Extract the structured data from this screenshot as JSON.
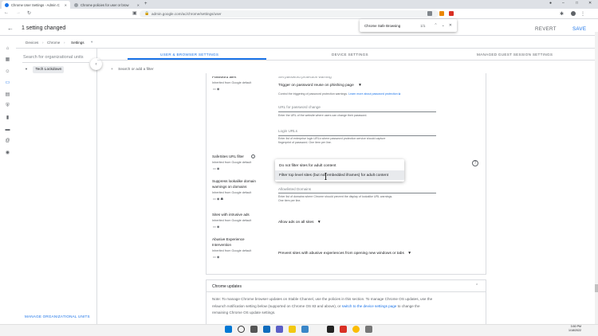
{
  "browser": {
    "tabs": [
      {
        "label": "Chrome User Settings - Admin C",
        "active": true
      },
      {
        "label": "Chrome policies for user or brow",
        "active": false
      }
    ],
    "url": "admin.google.com/ac/chrome/settings/user",
    "find": {
      "query": "Chrome Safe Browsing",
      "count": "1/1"
    }
  },
  "header": {
    "title": "1 setting changed",
    "revert_label": "REVERT",
    "save_label": "SAVE"
  },
  "breadcrumb": [
    "Devices",
    "Chrome",
    "Settings"
  ],
  "org": {
    "search_placeholder": "Search for organizational units",
    "selected": "Tech Lockdown",
    "manage_label": "MANAGE ORGANIZATIONAL UNITS"
  },
  "filter": {
    "placeholder": "Search or add a filter"
  },
  "tabs": [
    {
      "label": "USER & BROWSER SETTINGS",
      "active": true
    },
    {
      "label": "DEVICE SETTINGS",
      "active": false
    },
    {
      "label": "MANAGED GUEST SESSION SETTINGS",
      "active": false
    }
  ],
  "settings": {
    "password": {
      "label": "Password alert",
      "inherited": "Inherited from Google default",
      "warning_label": "Set password protection warning",
      "warning_value": "Trigger on password reuse on phishing page",
      "warning_desc": "Control the triggering of password protection warnings.",
      "warning_link": "Learn more about password protection",
      "change_url_label": "URL for password change",
      "change_url_desc": "Enter the URL of the website where users can change their password.",
      "login_urls_label": "Login URLs",
      "login_urls_desc_1": "Enter list of enterprise login URLs where password protection service should capture",
      "login_urls_desc_2": "fingerprint of password. One item per line."
    },
    "safesites": {
      "label": "SafeSites URL filter",
      "inherited": "Inherited from Google default",
      "options": [
        "Do not filter sites for adult content",
        "Filter top level sites (but not embedded iframes) for adult content"
      ]
    },
    "lookalike": {
      "label_1": "Suppress lookalike domain",
      "label_2": "warnings on domains",
      "inherited": "Inherited from Google default",
      "allowed_label": "Allowlisted Domains",
      "allowed_desc_1": "Enter list of domains where Chrome should prevent the display of lookalike URL warnings.",
      "allowed_desc_2": "One item per line."
    },
    "intrusive_ads": {
      "label": "Sites with intrusive ads",
      "inherited": "Inherited from Google default",
      "value": "Allow ads on all sites"
    },
    "abusive": {
      "label_1": "Abusive Experience",
      "label_2": "Intervention",
      "inherited": "Inherited from Google default",
      "value": "Prevent sites with abusive experiences from opening new windows or tabs"
    }
  },
  "updates": {
    "title": "Chrome updates",
    "line1": "Note: To manage Chrome browser updates on Stable Channel, use the policies in this section. To manage Chrome OS updates, use the",
    "line2_a": "relaunch notification setting below (supported on Chrome OS 83 and above), or",
    "line2_link": "switch to the device settings page",
    "line2_b": "to change the",
    "line3": "remaining Chrome OS update settings."
  },
  "taskbar": {
    "time": "3:50 PM",
    "date": "1/18/2022"
  },
  "colors": {
    "accent": "#1a73e8",
    "text": "#202124",
    "muted": "#5f6368"
  }
}
